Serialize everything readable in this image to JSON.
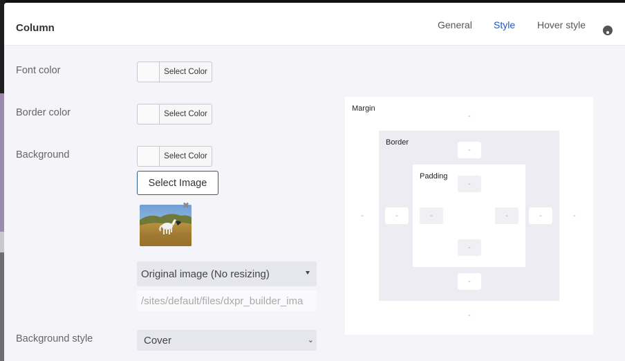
{
  "modal": {
    "title": "Column",
    "tabs": [
      {
        "label": "General",
        "active": false
      },
      {
        "label": "Style",
        "active": true
      },
      {
        "label": "Hover style",
        "active": false
      }
    ]
  },
  "form": {
    "font_color": {
      "label": "Font color",
      "button": "Select Color"
    },
    "border_color": {
      "label": "Border color",
      "button": "Select Color"
    },
    "background": {
      "label": "Background",
      "button": "Select Color",
      "image_button": "Select Image",
      "image_alt": "horse-thumbnail",
      "resize_option": "Original image (No resizing)",
      "path_value": "/sites/default/files/dxpr_builder_ima"
    },
    "background_style": {
      "label": "Background style",
      "value": "Cover"
    }
  },
  "box_model": {
    "margin": {
      "label": "Margin",
      "top": "-",
      "right": "-",
      "bottom": "-",
      "left": "-"
    },
    "border": {
      "label": "Border",
      "top": "-",
      "right": "-",
      "bottom": "-",
      "left": "-"
    },
    "padding": {
      "label": "Padding",
      "top": "-",
      "right": "-",
      "bottom": "-",
      "left": "-"
    }
  },
  "colors": {
    "accent": "#1a55c6",
    "outline_button": "#2a5d8e",
    "panel_bg": "#f4f4f9"
  }
}
